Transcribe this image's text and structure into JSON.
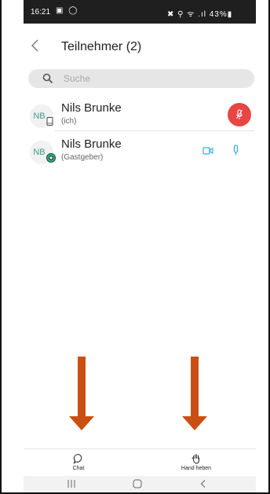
{
  "status_bar": {
    "time": "16:21",
    "left_icons": "▣ ◯",
    "right_text": "✖ ⚲ ᯤ .ıl 43%▮",
    "battery": "43%"
  },
  "header": {
    "back_icon": "chevron-left-icon",
    "title": "Teilnehmer (2)"
  },
  "search": {
    "placeholder": "Suche",
    "value": ""
  },
  "participants": [
    {
      "initials": "NB",
      "name": "Nils Brunke",
      "role": "(ich)",
      "badge": "phone-icon",
      "action": "muted-mic-button",
      "action_color": "#e84545"
    },
    {
      "initials": "NB",
      "name": "Nils Brunke",
      "role": "(Gastgeber)",
      "badge": "host-badge-icon",
      "video_icon": "video-camera-icon",
      "mic_icon": "microphone-icon",
      "icon_color": "#33aadd"
    }
  ],
  "bottom_bar": {
    "chat_label": "Chat",
    "hand_label": "Hand heben"
  },
  "annotation": {
    "arrow_color": "#c94f12"
  },
  "colors": {
    "accent_teal": "#3a9b8e",
    "status_bar_bg": "#1f1f1f"
  }
}
